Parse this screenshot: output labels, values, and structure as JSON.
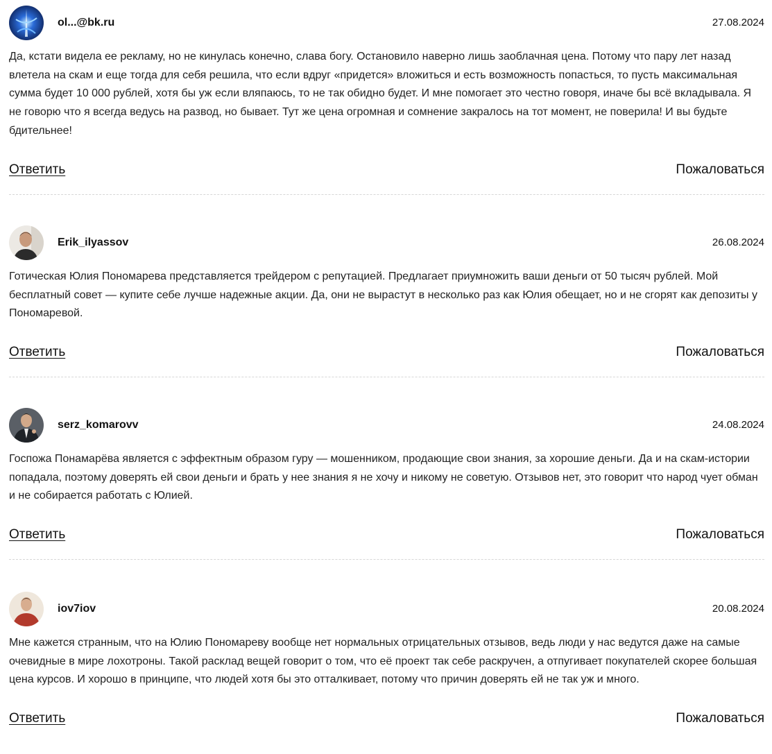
{
  "comments": [
    {
      "username": "ol...@bk.ru",
      "date": "27.08.2024",
      "avatar_icon": "blue-abstract-avatar",
      "text": "Да, кстати видела ее рекламу, но не кинулась конечно, слава богу. Остановило наверно лишь заоблачная цена. Потому что пару лет назад влетела на скам и еще тогда для себя решила, что если вдруг «придется» вложиться и есть возможность попасться, то пусть максимальная сумма будет 10 000 рублей, хотя бы уж если вляпаюсь, то не так обидно будет. И мне помогает это честно говоря, иначе бы всё вкладывала. Я не говорю что я всегда ведусь на развод, но бывает. Тут же цена огромная и сомнение закралось на тот момент, не поверила! И вы будьте бдительнее!",
      "reply_label": "Ответить",
      "report_label": "Пожаловаться"
    },
    {
      "username": "Erik_ilyassov",
      "date": "26.08.2024",
      "avatar_icon": "man-photo-avatar",
      "text": "Готическая Юлия Пономарева представляется трейдером с репутацией. Предлагает приумножить ваши деньги от 50 тысяч рублей. Мой бесплатный совет — купите себе лучше надежные акции. Да, они не вырастут в несколько раз как Юлия обещает, но и не сгорят как депозиты у Пономаревой.",
      "reply_label": "Ответить",
      "report_label": "Пожаловаться"
    },
    {
      "username": "serz_komarovv",
      "date": "24.08.2024",
      "avatar_icon": "man-in-suit-avatar",
      "text": "Госпожа Понамарёва является с эффектным образом гуру — мошенником, продающие свои знания, за хорошие деньги. Да и на скам-истории попадала, поэтому доверять ей свои деньги и брать у нее знания я не хочу и никому не советую. Отзывов нет, это говорит что народ чует обман и не собирается работать с Юлией.",
      "reply_label": "Ответить",
      "report_label": "Пожаловаться"
    },
    {
      "username": "iov7iov",
      "date": "20.08.2024",
      "avatar_icon": "man-red-shirt-avatar",
      "text": "Мне кажется странным, что на Юлию Пономареву вообще нет нормальных отрицательных отзывов, ведь люди у нас ведутся даже на самые очевидные в мире лохотроны. Такой расклад вещей говорит о том, что её проект так себе раскручен, а отпугивает покупателей скорее большая цена курсов. И хорошо в принципе, что людей хотя бы это отталкивает, потому что причин доверять ей не так уж и много.",
      "reply_label": "Ответить",
      "report_label": "Пожаловаться"
    }
  ]
}
